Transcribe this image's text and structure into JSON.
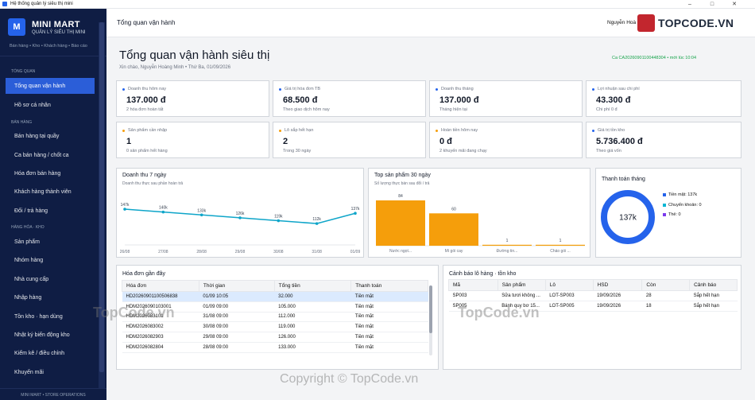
{
  "window": {
    "title": "Hệ thống quản lý siêu thị mini"
  },
  "brand": {
    "logo_letter": "M",
    "name": "MINI MART",
    "subtitle": "QUẢN LÝ SIÊU THỊ MINI",
    "tagline": "Bán hàng • Kho • Khách hàng • Báo cáo"
  },
  "sidebar": {
    "sections": [
      "TỔNG QUAN",
      "BÁN HÀNG",
      "HÀNG HÓA · KHO"
    ],
    "items": [
      "Tổng quan vận hành",
      "Hồ sơ cá nhân",
      "Bán hàng tại quầy",
      "Ca bán hàng / chốt ca",
      "Hóa đơn bán hàng",
      "Khách hàng thành viên",
      "Đổi / trả hàng",
      "Sản phẩm",
      "Nhóm hàng",
      "Nhà cung cấp",
      "Nhập hàng",
      "Tồn kho · hạn dùng",
      "Nhật ký biến động kho",
      "Kiểm kê / điều chỉnh",
      "Khuyến mãi"
    ],
    "footer": "MINI MART • STORE OPERATIONS"
  },
  "topbar": {
    "breadcrumb": "Tổng quan vận hành",
    "user": "Nguyễn Hoà",
    "badge_text": "TOPCODE.VN"
  },
  "page": {
    "title": "Tổng quan vận hành siêu thị",
    "greeting": "Xin chào, Nguyễn Hoàng Minh • Thứ Ba, 01/09/2026",
    "shift": "Ca CA20260901100448304 • mới lúc 10:04"
  },
  "kpis": [
    {
      "label": "Doanh thu hôm nay",
      "value": "137.000 đ",
      "sub": "2 hóa đơn hoàn tất",
      "color": "#2563eb"
    },
    {
      "label": "Giá trị hóa đơn TB",
      "value": "68.500 đ",
      "sub": "Theo giao dịch hôm nay",
      "color": "#2563eb"
    },
    {
      "label": "Doanh thu tháng",
      "value": "137.000 đ",
      "sub": "Tháng hiện tại",
      "color": "#2563eb"
    },
    {
      "label": "Lợi nhuận sau chi phí",
      "value": "43.300 đ",
      "sub": "Chi phí 0 đ",
      "color": "#2563eb"
    },
    {
      "label": "Sản phẩm cần nhập",
      "value": "1",
      "sub": "0 sản phẩm hết hàng",
      "color": "#f59e0b"
    },
    {
      "label": "Lô sắp hết hạn",
      "value": "2",
      "sub": "Trong 30 ngày",
      "color": "#f59e0b"
    },
    {
      "label": "Hoàn tiền hôm nay",
      "value": "0 đ",
      "sub": "2 khuyến mãi đang chạy",
      "color": "#f59e0b"
    },
    {
      "label": "Giá trị tồn kho",
      "value": "5.736.400 đ",
      "sub": "Theo giá vốn",
      "color": "#2563eb"
    }
  ],
  "chart_data": [
    {
      "type": "line",
      "title": "Doanh thu 7 ngày",
      "subtitle": "Doanh thu thực sau phần hoàn trả",
      "categories": [
        "26/08",
        "27/08",
        "28/08",
        "29/08",
        "30/08",
        "31/08",
        "01/09"
      ],
      "values": [
        147,
        140,
        133,
        126,
        119,
        112,
        137
      ],
      "data_labels": [
        "147k",
        "140k",
        "133k",
        "126k",
        "119k",
        "112k",
        "137k"
      ],
      "color": "#0ea5c9"
    },
    {
      "type": "bar",
      "title": "Top sản phẩm 30 ngày",
      "subtitle": "Số lượng thực bán sau đổi / trả",
      "categories": [
        "Nước ngọt...",
        "Mì gói cay",
        "Đường tin...",
        "Cháo gói ..."
      ],
      "values": [
        84,
        60,
        1,
        1
      ],
      "color": "#f59e0b"
    },
    {
      "type": "pie",
      "title": "Thanh toán tháng",
      "center_label": "137k",
      "slices": [
        {
          "name": "Tiền mặt: 137k",
          "value": 137,
          "color": "#2563eb"
        },
        {
          "name": "Chuyển khoản: 0",
          "value": 0,
          "color": "#06b6d4"
        },
        {
          "name": "Thẻ: 0",
          "value": 0,
          "color": "#7c3aed"
        }
      ]
    }
  ],
  "invoices": {
    "title": "Hóa đơn gần đây",
    "columns": [
      "Hóa đơn",
      "Thời gian",
      "Tổng tiền",
      "Thanh toán"
    ],
    "rows": [
      [
        "HD20260901100506838",
        "01/09 10:05",
        "32.000",
        "Tiền mặt"
      ],
      [
        "HDM2026090103001",
        "01/09 09:00",
        "105.000",
        "Tiền mặt"
      ],
      [
        "HDM2026083101",
        "31/08 09:00",
        "112.000",
        "Tiền mặt"
      ],
      [
        "HDM2026083002",
        "30/08 09:00",
        "119.000",
        "Tiền mặt"
      ],
      [
        "HDM2026082903",
        "29/08 09:00",
        "126.000",
        "Tiền mặt"
      ],
      [
        "HDM2026082804",
        "28/08 09:00",
        "133.000",
        "Tiền mặt"
      ]
    ]
  },
  "alerts": {
    "title": "Cảnh báo lô hàng · tồn kho",
    "columns": [
      "Mã",
      "Sản phẩm",
      "Lô",
      "HSD",
      "Còn",
      "Cảnh báo"
    ],
    "rows": [
      [
        "SP003",
        "Sữa tươi không ...",
        "LOT-SP003",
        "19/09/2026",
        "28",
        "Sắp hết hạn"
      ],
      [
        "SP005",
        "Bánh quy bơ 15...",
        "LOT-SP005",
        "19/09/2026",
        "18",
        "Sắp hết hạn"
      ]
    ]
  },
  "watermarks": {
    "a": "TopCode.vn",
    "b": "Copyright © TopCode.vn",
    "c": "TopCode.vn"
  }
}
